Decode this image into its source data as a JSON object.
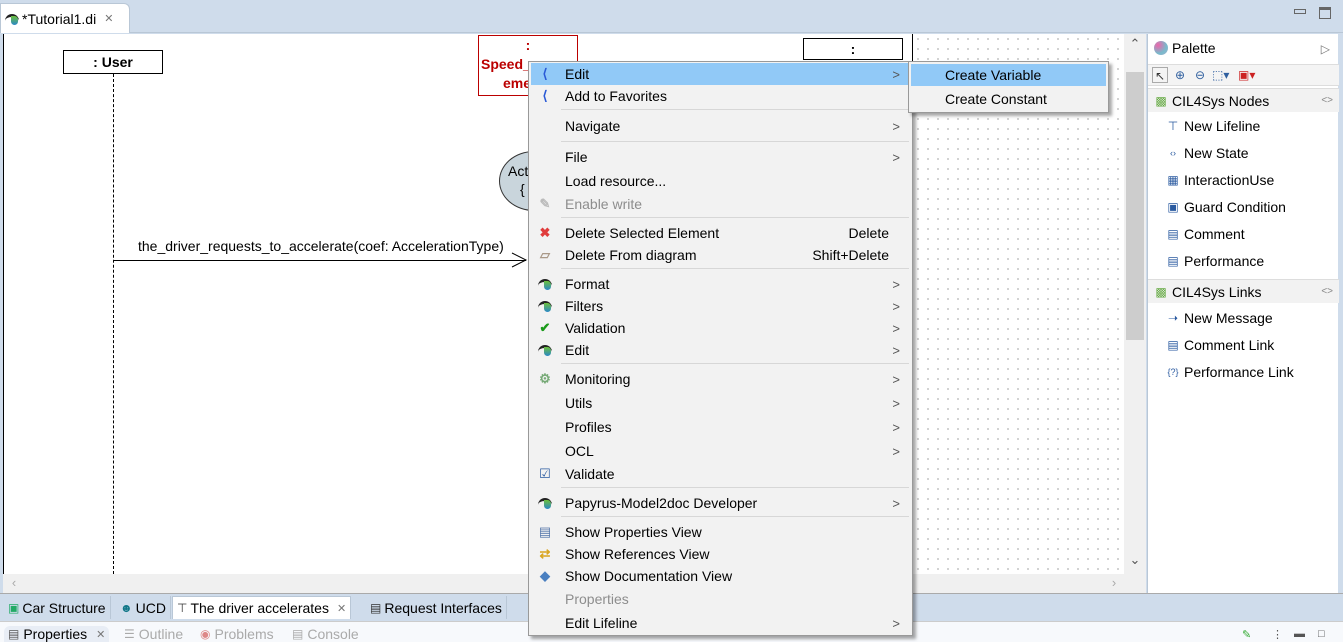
{
  "editor": {
    "tab_label": "*Tutorial1.di",
    "tab_close": "✕"
  },
  "diagram": {
    "lifelines": [
      {
        "label": ": User"
      },
      {
        "label_line1": ":",
        "label_line2": "Speed_",
        "label_line3": "emer"
      },
      {
        "label": ":"
      }
    ],
    "state_partial_line1": "Act",
    "state_partial_line2": "{",
    "message_label": "the_driver_requests_to_accelerate(coef: AccelerationType)"
  },
  "context_menu": {
    "items": [
      {
        "label": "Edit",
        "icon": "edit-back-icon",
        "submenu": true,
        "highlighted": true
      },
      {
        "label": "Add to Favorites",
        "icon": "edit-back-icon"
      },
      {
        "label": "Navigate",
        "submenu": true
      },
      {
        "label": "File",
        "submenu": true
      },
      {
        "label": "Load resource..."
      },
      {
        "label": "Enable write",
        "icon": "pencil-icon",
        "disabled": true
      },
      {
        "label": "Delete Selected Element",
        "icon": "red-x-icon",
        "shortcut": "Delete"
      },
      {
        "label": "Delete From diagram",
        "icon": "eraser-icon",
        "shortcut": "Shift+Delete"
      },
      {
        "label": "Format",
        "icon": "papyrus-icon",
        "submenu": true
      },
      {
        "label": "Filters",
        "icon": "papyrus-icon",
        "submenu": true
      },
      {
        "label": "Validation",
        "icon": "checkmark-icon",
        "submenu": true
      },
      {
        "label": "Edit",
        "icon": "papyrus-icon",
        "submenu": true
      },
      {
        "label": "Monitoring",
        "icon": "gear-icon",
        "submenu": true
      },
      {
        "label": "Utils",
        "submenu": true
      },
      {
        "label": "Profiles",
        "submenu": true
      },
      {
        "label": "OCL",
        "submenu": true
      },
      {
        "label": "Validate",
        "icon": "checkbox-icon"
      },
      {
        "label": "Papyrus-Model2doc Developer",
        "icon": "papyrus-icon",
        "submenu": true
      },
      {
        "label": "Show Properties View",
        "icon": "table-icon"
      },
      {
        "label": "Show References View",
        "icon": "references-icon"
      },
      {
        "label": "Show Documentation View",
        "icon": "book-icon"
      },
      {
        "label": "Properties",
        "disabled": true
      },
      {
        "label": "Edit Lifeline",
        "submenu": true
      }
    ],
    "submenu_arrow": ">"
  },
  "submenu": {
    "items": [
      {
        "label": "Create Variable",
        "highlighted": true
      },
      {
        "label": "Create Constant"
      }
    ]
  },
  "palette": {
    "title": "Palette",
    "drawers": [
      {
        "label": "CIL4Sys Nodes",
        "items": [
          {
            "label": "New Lifeline",
            "icon": "lifeline-icon"
          },
          {
            "label": "New State",
            "icon": "state-icon"
          },
          {
            "label": "InteractionUse",
            "icon": "interaction-use-icon"
          },
          {
            "label": "Guard Condition",
            "icon": "guard-condition-icon"
          },
          {
            "label": "Comment",
            "icon": "comment-icon"
          },
          {
            "label": "Performance",
            "icon": "comment-icon"
          }
        ]
      },
      {
        "label": "CIL4Sys Links",
        "items": [
          {
            "label": "New Message",
            "icon": "arrow-right-icon"
          },
          {
            "label": "Comment Link",
            "icon": "comment-icon"
          },
          {
            "label": "Performance Link",
            "icon": "question-braces-icon"
          }
        ]
      }
    ]
  },
  "bottom_tabs": [
    {
      "label": "Car Structure",
      "icon": "class-diagram-icon"
    },
    {
      "label": "UCD",
      "icon": "use-case-icon"
    },
    {
      "label": "The driver accelerates",
      "icon": "sequence-diagram-icon",
      "active": true
    },
    {
      "label": "Request Interfaces",
      "icon": "interfaces-icon"
    }
  ],
  "views": [
    {
      "label": "Properties",
      "active": true
    },
    {
      "label": "Outline"
    },
    {
      "label": "Problems"
    },
    {
      "label": "Console"
    }
  ]
}
